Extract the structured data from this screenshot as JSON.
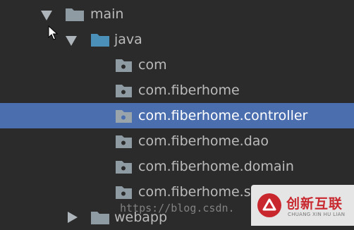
{
  "tree": {
    "main": {
      "label": "main",
      "expanded": true,
      "icon": "folder-icon"
    },
    "java": {
      "label": "java",
      "expanded": true,
      "icon": "source-folder-icon"
    },
    "packages": [
      {
        "label": "com",
        "selected": false,
        "icon": "package-icon"
      },
      {
        "label": "com.fiberhome",
        "selected": false,
        "icon": "package-icon"
      },
      {
        "label": "com.fiberhome.controller",
        "selected": true,
        "icon": "package-icon"
      },
      {
        "label": "com.fiberhome.dao",
        "selected": false,
        "icon": "package-icon"
      },
      {
        "label": "com.fiberhome.domain",
        "selected": false,
        "icon": "package-icon"
      },
      {
        "label": "com.fiberhome.s",
        "selected": false,
        "icon": "package-icon"
      }
    ],
    "webapp": {
      "label": "webapp",
      "expanded": false,
      "icon": "folder-icon"
    }
  },
  "watermark": {
    "url": "https://blog.csdn.",
    "logo_text_cn": "创新互联",
    "logo_text_en": "CHUANG XIN HU LIAN"
  },
  "colors": {
    "background": "#2b2b2b",
    "selection": "#4b6eaf",
    "text": "#bbbbbb",
    "selected_text": "#ffffff",
    "folder": "#8f9ba3",
    "source_folder": "#4a90b8",
    "arrow": "#aeb5ba",
    "logo_red": "#c9272e"
  }
}
